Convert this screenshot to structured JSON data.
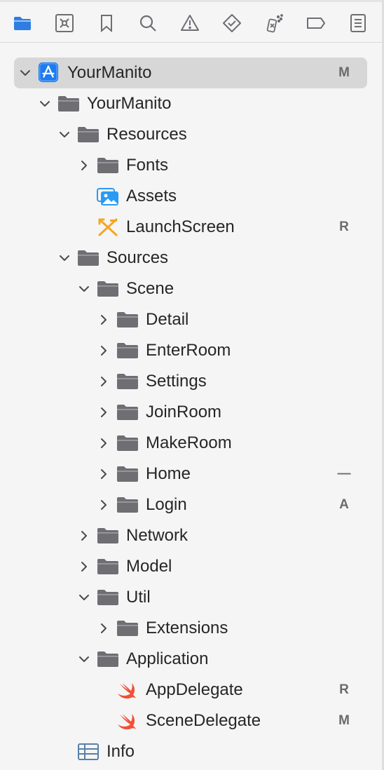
{
  "toolbar": {
    "icons": [
      "folder-icon",
      "source-control-icon",
      "bookmark-icon",
      "search-icon",
      "warning-icon",
      "test-icon",
      "debug-icon",
      "breakpoint-icon",
      "report-icon"
    ]
  },
  "colors": {
    "accent": "#2f7de1",
    "folder": "#6e6e73",
    "swift": "#f05138",
    "launch": "#f5a623",
    "selection": "#d7d7d7"
  },
  "tree": [
    {
      "name": "YourManito",
      "kind": "project",
      "indent": 0,
      "disclosure": "open",
      "badge": "M",
      "selected": true
    },
    {
      "name": "YourManito",
      "kind": "folder",
      "indent": 1,
      "disclosure": "open",
      "badge": ""
    },
    {
      "name": "Resources",
      "kind": "folder",
      "indent": 2,
      "disclosure": "open",
      "badge": ""
    },
    {
      "name": "Fonts",
      "kind": "folder",
      "indent": 3,
      "disclosure": "closed",
      "badge": ""
    },
    {
      "name": "Assets",
      "kind": "assets",
      "indent": 3,
      "disclosure": "none",
      "badge": ""
    },
    {
      "name": "LaunchScreen",
      "kind": "storyboard",
      "indent": 3,
      "disclosure": "none",
      "badge": "R"
    },
    {
      "name": "Sources",
      "kind": "folder",
      "indent": 2,
      "disclosure": "open",
      "badge": ""
    },
    {
      "name": "Scene",
      "kind": "folder",
      "indent": 3,
      "disclosure": "open",
      "badge": ""
    },
    {
      "name": "Detail",
      "kind": "folder",
      "indent": 4,
      "disclosure": "closed",
      "badge": ""
    },
    {
      "name": "EnterRoom",
      "kind": "folder",
      "indent": 4,
      "disclosure": "closed",
      "badge": ""
    },
    {
      "name": "Settings",
      "kind": "folder",
      "indent": 4,
      "disclosure": "closed",
      "badge": ""
    },
    {
      "name": "JoinRoom",
      "kind": "folder",
      "indent": 4,
      "disclosure": "closed",
      "badge": ""
    },
    {
      "name": "MakeRoom",
      "kind": "folder",
      "indent": 4,
      "disclosure": "closed",
      "badge": ""
    },
    {
      "name": "Home",
      "kind": "folder",
      "indent": 4,
      "disclosure": "closed",
      "badge": "—"
    },
    {
      "name": "Login",
      "kind": "folder",
      "indent": 4,
      "disclosure": "closed",
      "badge": "A"
    },
    {
      "name": "Network",
      "kind": "folder",
      "indent": 3,
      "disclosure": "closed",
      "badge": ""
    },
    {
      "name": "Model",
      "kind": "folder",
      "indent": 3,
      "disclosure": "closed",
      "badge": ""
    },
    {
      "name": "Util",
      "kind": "folder",
      "indent": 3,
      "disclosure": "open",
      "badge": ""
    },
    {
      "name": "Extensions",
      "kind": "folder",
      "indent": 4,
      "disclosure": "closed",
      "badge": ""
    },
    {
      "name": "Application",
      "kind": "folder",
      "indent": 3,
      "disclosure": "open",
      "badge": ""
    },
    {
      "name": "AppDelegate",
      "kind": "swift",
      "indent": 4,
      "disclosure": "none",
      "badge": "R"
    },
    {
      "name": "SceneDelegate",
      "kind": "swift",
      "indent": 4,
      "disclosure": "none",
      "badge": "M"
    },
    {
      "name": "Info",
      "kind": "plist",
      "indent": 2,
      "disclosure": "none",
      "badge": ""
    }
  ]
}
